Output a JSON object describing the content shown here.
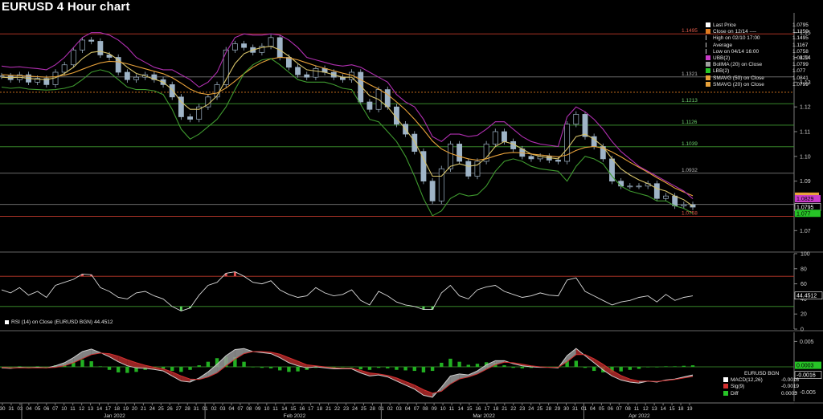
{
  "title": "EURUSD 4 Hour chart",
  "colors": {
    "background": "#000000",
    "candle": "#9fb4c7",
    "bollinger_upper": "#b02fb0",
    "bollinger_lower": "#3f9a2f",
    "smavg50": "#e8a23a",
    "smavg20": "#d7c36a",
    "resistance": "#c0392b",
    "fib": "#5a8a3a",
    "rsi_line": "#d9d9d9",
    "macd_line": "#cfcfcf",
    "signal_line": "#d22f2f",
    "diff": "#2fcf2f",
    "grid": "#3a3a3a"
  },
  "main_legend": [
    {
      "label": "Last Price",
      "value": "1.0795",
      "color": "#ffffff"
    },
    {
      "label": "Close on 12/14 ----",
      "value": "1.1259",
      "color": "#e07b1f"
    },
    {
      "label": "High on 02/10 17:00",
      "value": "1.1495",
      "color": ""
    },
    {
      "label": "Average",
      "value": "1.1167",
      "color": ""
    },
    {
      "label": "Low on 04/14 16:00",
      "value": "1.0758",
      "color": ""
    },
    {
      "label": "UBB(2)",
      "value": "1.0829",
      "color": "#c93bc9"
    },
    {
      "label": "BollMA (20)  on Close",
      "value": "1.0799",
      "color": "#9f9f9f"
    },
    {
      "label": "LBB(2)",
      "value": "1.077",
      "color": "#27c427"
    },
    {
      "label": "SMAVG (50)  on Close",
      "value": "1.0841",
      "color": "#e8a23a"
    },
    {
      "label": "SMAVG (20)  on Close",
      "value": "1.0799",
      "color": "#e8a23a"
    }
  ],
  "rsi_legend": "RSI (14)  on Close (EURUSD BGN) 44.4512",
  "macd_legend": {
    "title": "EURUSD BGN",
    "rows": [
      {
        "label": "MACD(12,26)",
        "value": "-0.0016",
        "color": "#ffffff"
      },
      {
        "label": "Sig(9)",
        "value": "-0.0019",
        "color": "#d22f2f"
      },
      {
        "label": "Diff",
        "value": "0.0003",
        "color": "#27c427"
      }
    ]
  },
  "chart_data": [
    {
      "type": "line",
      "title": "EURUSD 4 Hour chart",
      "ylim": [
        1.062,
        1.158
      ],
      "y_ticks": [
        "1.15",
        "1.14",
        "1.13",
        "1.12",
        "1.11",
        "1.10",
        "1.09",
        "1.08",
        "1.07"
      ],
      "levels": [
        {
          "value": 1.1495,
          "label": "1.1495",
          "color": "#c0392b"
        },
        {
          "value": 1.1321,
          "label": "1.1321",
          "color": "#7a7a7a"
        },
        {
          "value": 1.1259,
          "label": "",
          "color": "#e07b1f"
        },
        {
          "value": 1.1213,
          "label": "1.1213",
          "color": "#3f9a2f"
        },
        {
          "value": 1.1126,
          "label": "1.1126",
          "color": "#3f9a2f"
        },
        {
          "value": 1.1039,
          "label": "1.1039",
          "color": "#3f9a2f"
        },
        {
          "value": 1.0932,
          "label": "1.0932",
          "color": "#7a7a7a"
        },
        {
          "value": 1.0806,
          "label": "",
          "color": "#7a7a7a"
        },
        {
          "value": 1.0758,
          "label": "1.0758",
          "color": "#c0392b"
        }
      ],
      "last_price_labels": [
        {
          "value": 1.0841,
          "label": "",
          "color": "#e8a23a"
        },
        {
          "value": 1.0829,
          "label": "1.0829",
          "color": "#c93bc9"
        },
        {
          "value": 1.0795,
          "label": "1.0795",
          "color": "#ffffff"
        },
        {
          "value": 1.077,
          "label": "1.077",
          "color": "#27c427"
        }
      ],
      "x_day_labels": [
        "30",
        "31",
        "03",
        "04",
        "05",
        "06",
        "07",
        "10",
        "11",
        "12",
        "13",
        "14",
        "17",
        "18",
        "19",
        "20",
        "21",
        "24",
        "25",
        "26",
        "27",
        "28",
        "31",
        "01",
        "02",
        "03",
        "04",
        "07",
        "08",
        "09",
        "10",
        "11",
        "14",
        "15",
        "16",
        "17",
        "18",
        "21",
        "22",
        "23",
        "24",
        "25",
        "28",
        "01",
        "02",
        "03",
        "04",
        "07",
        "08",
        "09",
        "10",
        "11",
        "14",
        "15",
        "16",
        "17",
        "18",
        "21",
        "22",
        "23",
        "24",
        "25",
        "28",
        "29",
        "30",
        "31",
        "01",
        "04",
        "05",
        "06",
        "07",
        "08",
        "11",
        "12",
        "13",
        "14",
        "15",
        "18",
        "19"
      ],
      "x_month_labels": [
        "Jan 2022",
        "Feb 2022",
        "Mar 2022",
        "Apr 2022"
      ],
      "series": [
        {
          "name": "Last Price",
          "values": [
            1.1325,
            1.131,
            1.133,
            1.13,
            1.1315,
            1.129,
            1.134,
            1.137,
            1.143,
            1.147,
            1.1465,
            1.141,
            1.14,
            1.134,
            1.131,
            1.132,
            1.133,
            1.131,
            1.129,
            1.124,
            1.116,
            1.115,
            1.12,
            1.124,
            1.129,
            1.143,
            1.1455,
            1.144,
            1.142,
            1.1445,
            1.148,
            1.14,
            1.136,
            1.133,
            1.132,
            1.1355,
            1.134,
            1.132,
            1.131,
            1.134,
            1.122,
            1.119,
            1.127,
            1.12,
            1.113,
            1.109,
            1.102,
            1.09,
            1.082,
            1.095,
            1.105,
            1.098,
            1.092,
            1.098,
            1.105,
            1.11,
            1.106,
            1.103,
            1.1,
            1.099,
            1.1,
            1.0985,
            1.098,
            1.113,
            1.117,
            1.108,
            1.104,
            1.099,
            1.09,
            1.088,
            1.088,
            1.088,
            1.089,
            1.083,
            1.084,
            1.08,
            1.0805,
            1.0795
          ]
        },
        {
          "name": "SMAVG (20)  on Close",
          "values": [
            1.132,
            1.1318,
            1.132,
            1.1315,
            1.1312,
            1.131,
            1.1318,
            1.1335,
            1.136,
            1.1395,
            1.142,
            1.1425,
            1.1415,
            1.139,
            1.136,
            1.1335,
            1.1325,
            1.1312,
            1.13,
            1.127,
            1.122,
            1.119,
            1.119,
            1.121,
            1.1245,
            1.131,
            1.1375,
            1.1415,
            1.143,
            1.144,
            1.1445,
            1.143,
            1.1405,
            1.1375,
            1.135,
            1.1345,
            1.134,
            1.133,
            1.132,
            1.132,
            1.1285,
            1.1245,
            1.123,
            1.12,
            1.1155,
            1.111,
            1.106,
            1.099,
            1.092,
            1.092,
            1.096,
            1.097,
            1.096,
            1.0965,
            1.0995,
            1.104,
            1.106,
            1.105,
            1.103,
            1.101,
            1.1,
            1.0995,
            1.099,
            1.103,
            1.108,
            1.109,
            1.107,
            1.104,
            1.099,
            1.095,
            1.0925,
            1.0905,
            1.089,
            1.087,
            1.086,
            1.084,
            1.0825,
            1.0799
          ]
        },
        {
          "name": "SMAVG (50)  on Close",
          "values": [
            1.133,
            1.1328,
            1.1326,
            1.1324,
            1.1322,
            1.132,
            1.1322,
            1.1328,
            1.1338,
            1.1352,
            1.1366,
            1.1378,
            1.1384,
            1.1382,
            1.1374,
            1.1364,
            1.1354,
            1.1344,
            1.1334,
            1.1318,
            1.1296,
            1.1272,
            1.1256,
            1.125,
            1.1256,
            1.1276,
            1.1304,
            1.1334,
            1.136,
            1.138,
            1.1394,
            1.14,
            1.1398,
            1.139,
            1.1378,
            1.1366,
            1.1356,
            1.1346,
            1.1336,
            1.1328,
            1.131,
            1.129,
            1.1272,
            1.125,
            1.122,
            1.1188,
            1.115,
            1.1108,
            1.1062,
            1.103,
            1.1012,
            1.1,
            1.099,
            1.0985,
            1.099,
            1.1002,
            1.1012,
            1.1016,
            1.1014,
            1.101,
            1.1006,
            1.1002,
            1.0998,
            1.1006,
            1.1024,
            1.1036,
            1.104,
            1.1034,
            1.1018,
            1.0998,
            1.0976,
            1.0956,
            1.0936,
            1.0914,
            1.0894,
            1.0872,
            1.0856,
            1.0841
          ]
        },
        {
          "name": "UBB(2)",
          "values": [
            1.1365,
            1.136,
            1.1362,
            1.1358,
            1.1355,
            1.135,
            1.137,
            1.14,
            1.144,
            1.148,
            1.15,
            1.15,
            1.149,
            1.147,
            1.144,
            1.14,
            1.138,
            1.136,
            1.135,
            1.135,
            1.133,
            1.131,
            1.128,
            1.13,
            1.134,
            1.142,
            1.148,
            1.1495,
            1.149,
            1.149,
            1.1495,
            1.149,
            1.147,
            1.144,
            1.14,
            1.139,
            1.138,
            1.137,
            1.1365,
            1.137,
            1.136,
            1.134,
            1.132,
            1.13,
            1.125,
            1.122,
            1.12,
            1.115,
            1.108,
            1.106,
            1.109,
            1.109,
            1.108,
            1.1085,
            1.111,
            1.114,
            1.114,
            1.111,
            1.108,
            1.106,
            1.105,
            1.1045,
            1.104,
            1.116,
            1.12,
            1.118,
            1.115,
            1.111,
            1.106,
            1.102,
            1.099,
            1.096,
            1.094,
            1.092,
            1.09,
            1.088,
            1.086,
            1.0829
          ]
        },
        {
          "name": "LBB(2)",
          "values": [
            1.128,
            1.1275,
            1.1278,
            1.1272,
            1.127,
            1.1268,
            1.127,
            1.1275,
            1.1285,
            1.131,
            1.134,
            1.135,
            1.134,
            1.131,
            1.128,
            1.127,
            1.127,
            1.1265,
            1.125,
            1.119,
            1.111,
            1.107,
            1.109,
            1.112,
            1.115,
            1.12,
            1.127,
            1.1335,
            1.137,
            1.139,
            1.1395,
            1.137,
            1.134,
            1.131,
            1.13,
            1.13,
            1.13,
            1.129,
            1.1275,
            1.127,
            1.121,
            1.115,
            1.114,
            1.11,
            1.106,
            1.1,
            1.092,
            1.083,
            1.076,
            1.078,
            1.083,
            1.085,
            1.084,
            1.0845,
            1.088,
            1.094,
            1.098,
            1.099,
            1.098,
            1.096,
            1.095,
            1.0945,
            1.094,
            1.09,
            1.096,
            1.1,
            1.099,
            1.097,
            1.092,
            1.088,
            1.086,
            1.085,
            1.084,
            1.082,
            1.082,
            1.08,
            1.079,
            1.077
          ]
        }
      ]
    },
    {
      "type": "line",
      "title": "",
      "ylim": [
        0,
        100
      ],
      "y_ticks": [
        "100",
        "80",
        "60",
        "40",
        "20",
        "0"
      ],
      "levels": [
        {
          "value": 70,
          "label": "",
          "color": "#c0392b"
        },
        {
          "value": 30,
          "label": "",
          "color": "#3f9a2f"
        }
      ],
      "last_price_labels": [
        {
          "value": 44.4512,
          "label": "44.4512",
          "color": "#ffffff"
        }
      ],
      "series": [
        {
          "name": "RSI (14)",
          "values": [
            52,
            48,
            55,
            45,
            50,
            42,
            58,
            62,
            66,
            73,
            72,
            55,
            50,
            42,
            40,
            48,
            50,
            44,
            40,
            30,
            24,
            28,
            45,
            58,
            62,
            74,
            76,
            70,
            62,
            60,
            64,
            52,
            46,
            42,
            44,
            55,
            48,
            44,
            46,
            52,
            38,
            32,
            50,
            44,
            36,
            32,
            30,
            26,
            26,
            48,
            58,
            44,
            40,
            52,
            56,
            58,
            50,
            46,
            42,
            44,
            48,
            45,
            44,
            65,
            68,
            50,
            44,
            38,
            32,
            36,
            38,
            42,
            44,
            36,
            46,
            38,
            42,
            44
          ]
        }
      ]
    },
    {
      "type": "line",
      "title": "",
      "ylim": [
        -0.0068,
        0.0068
      ],
      "y_ticks": [
        "0.005",
        "-0.005"
      ],
      "last_price_labels": [
        {
          "value": 0.0003,
          "label": "0.0003",
          "color": "#27c427"
        },
        {
          "value": -0.0016,
          "label": "-0.0016",
          "color": "#ffffff"
        }
      ],
      "series": [
        {
          "name": "MACD(12,26)",
          "values": [
            -0.0002,
            -0.0003,
            -0.0001,
            -0.0002,
            -0.0001,
            -0.0002,
            0.0002,
            0.0008,
            0.0018,
            0.003,
            0.0035,
            0.0028,
            0.002,
            0.001,
            0.0002,
            -0.0002,
            -0.0003,
            -0.0005,
            -0.0008,
            -0.0018,
            -0.0028,
            -0.003,
            -0.0022,
            -0.001,
            0.0005,
            0.0022,
            0.0034,
            0.0036,
            0.003,
            0.0028,
            0.0026,
            0.0018,
            0.0008,
            0.0002,
            -0.0002,
            0.0,
            -0.0002,
            -0.0004,
            -0.0004,
            -0.0004,
            -0.0012,
            -0.0018,
            -0.0016,
            -0.002,
            -0.0028,
            -0.0036,
            -0.0044,
            -0.0056,
            -0.006,
            -0.004,
            -0.0018,
            -0.0014,
            -0.0016,
            -0.0008,
            0.0004,
            0.0012,
            0.0012,
            0.0006,
            0.0002,
            0.0,
            -0.0001,
            -0.0001,
            -0.0002,
            0.0022,
            0.0036,
            0.0022,
            0.0008,
            -0.0006,
            -0.0018,
            -0.0026,
            -0.003,
            -0.0032,
            -0.0028,
            -0.003,
            -0.0026,
            -0.0024,
            -0.002,
            -0.0016
          ]
        },
        {
          "name": "Sig(9)",
          "values": [
            -0.0001,
            -0.0002,
            -0.0002,
            -0.0002,
            -0.0002,
            -0.0002,
            -0.0001,
            0.0002,
            0.0008,
            0.0016,
            0.0024,
            0.0027,
            0.0026,
            0.0021,
            0.0014,
            0.0008,
            0.0003,
            -0.0001,
            -0.0004,
            -0.001,
            -0.0018,
            -0.0024,
            -0.0025,
            -0.002,
            -0.0012,
            0.0002,
            0.0015,
            0.0026,
            0.003,
            0.003,
            0.0029,
            0.0025,
            0.0018,
            0.0011,
            0.0004,
            0.0002,
            0.0,
            -0.0002,
            -0.0003,
            -0.0003,
            -0.0007,
            -0.0012,
            -0.0014,
            -0.0017,
            -0.0022,
            -0.0029,
            -0.0036,
            -0.0045,
            -0.0052,
            -0.0048,
            -0.0034,
            -0.0024,
            -0.002,
            -0.0014,
            -0.0005,
            0.0004,
            0.0009,
            0.0008,
            0.0005,
            0.0002,
            0.0,
            -0.0001,
            -0.0001,
            0.001,
            0.0024,
            0.0024,
            0.0016,
            0.0005,
            -0.0007,
            -0.0017,
            -0.0024,
            -0.0028,
            -0.0028,
            -0.0029,
            -0.0027,
            -0.0025,
            -0.0022,
            -0.0019
          ]
        }
      ]
    }
  ]
}
